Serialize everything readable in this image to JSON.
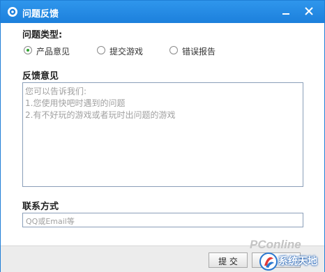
{
  "window": {
    "title": "问题反馈",
    "colors": {
      "titlebar": "#1c80dc",
      "accent_radio": "#2fa42f"
    },
    "icons": {
      "app": "app-icon",
      "minimize": "minimize-icon",
      "close": "close-icon"
    }
  },
  "problem_type": {
    "label": "问题类型:",
    "options": [
      {
        "label": "产品意见",
        "selected": true
      },
      {
        "label": "提交游戏",
        "selected": false
      },
      {
        "label": "错误报告",
        "selected": false
      }
    ]
  },
  "feedback": {
    "label": "反馈意见",
    "placeholder_lines": [
      "您可以告诉我们:",
      "1.您使用快吧时遇到的问题",
      "2.有不好玩的游戏或者玩时出问题的游戏"
    ]
  },
  "contact": {
    "label": "联系方式",
    "placeholder": "QQ或Email等"
  },
  "footer": {
    "submit_label": "提 交",
    "watermark_text": "PConline",
    "watermark_cn": "系统天地"
  }
}
